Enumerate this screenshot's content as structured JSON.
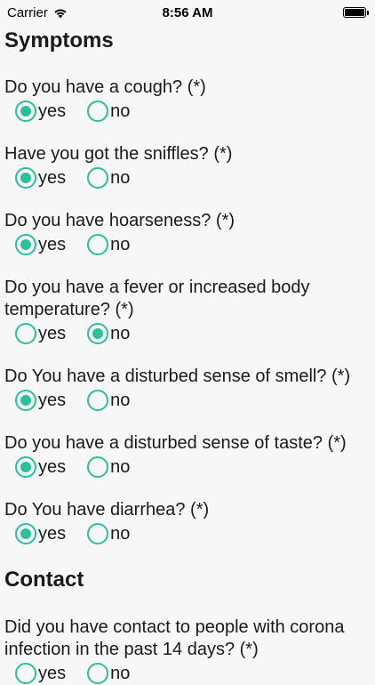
{
  "status_bar": {
    "carrier": "Carrier",
    "time": "8:56 AM"
  },
  "sections": {
    "symptoms_title": "Symptoms",
    "contact_title": "Contact"
  },
  "options": {
    "yes": "yes",
    "no": "no"
  },
  "questions": [
    {
      "text": "Do you have a cough? (*)",
      "selected": "yes"
    },
    {
      "text": "Have you got the sniffles? (*)",
      "selected": "yes"
    },
    {
      "text": "Do you have hoarseness? (*)",
      "selected": "yes"
    },
    {
      "text": "Do you have a fever or increased body temperature? (*)",
      "selected": "no"
    },
    {
      "text": "Do You have a disturbed sense of smell? (*)",
      "selected": "yes"
    },
    {
      "text": "Do you have a disturbed sense of taste? (*)",
      "selected": "yes"
    },
    {
      "text": "Do You have diarrhea? (*)",
      "selected": "yes"
    },
    {
      "text": "Did you have contact to people with corona infection in the past 14 days? (*)",
      "selected": ""
    }
  ],
  "colors": {
    "accent": "#2bbf9a",
    "background": "#f7f7f7"
  }
}
